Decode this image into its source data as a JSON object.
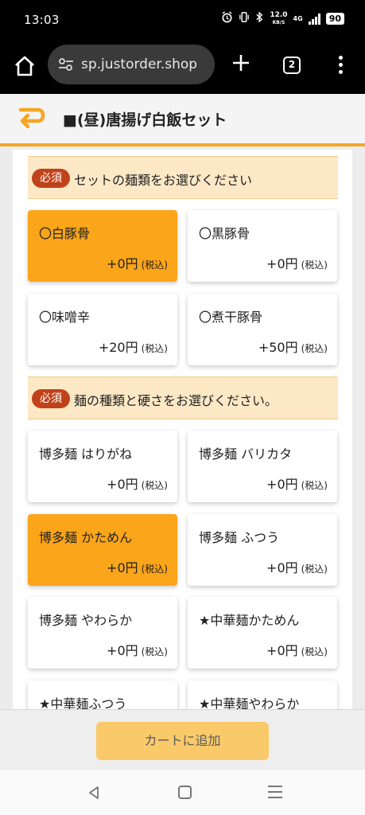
{
  "status_bar": {
    "time": "13:03",
    "speed_value": "12.0",
    "speed_unit": "KB/S",
    "network": "4G",
    "battery": "90",
    "icons": [
      "alarm-icon",
      "vibrate-icon",
      "bluetooth-icon",
      "signal-icon",
      "battery-icon"
    ]
  },
  "browser": {
    "url": "sp.justorder.shop",
    "tab_count": "2",
    "icons": [
      "home-icon",
      "site-settings-icon",
      "new-tab-icon",
      "tabs-icon",
      "menu-icon"
    ]
  },
  "page": {
    "title": "■(昼)唐揚げ白飯セット",
    "accent_color": "#f5a623",
    "selected_color": "#faa51a"
  },
  "sections": [
    {
      "badge": "必須",
      "text": "セットの麺類をお選びください",
      "options": [
        {
          "name": "〇白豚骨",
          "price": "+0円",
          "tax": "(税込)",
          "selected": true
        },
        {
          "name": "〇黒豚骨",
          "price": "+0円",
          "tax": "(税込)",
          "selected": false
        },
        {
          "name": "〇味噌辛",
          "price": "+20円",
          "tax": "(税込)",
          "selected": false
        },
        {
          "name": "〇煮干豚骨",
          "price": "+50円",
          "tax": "(税込)",
          "selected": false
        }
      ]
    },
    {
      "badge": "必須",
      "text": "麺の種類と硬さをお選びください。",
      "options": [
        {
          "name": "博多麺 はりがね",
          "price": "+0円",
          "tax": "(税込)",
          "selected": false
        },
        {
          "name": "博多麺 バリカタ",
          "price": "+0円",
          "tax": "(税込)",
          "selected": false
        },
        {
          "name": "博多麺 かためん",
          "price": "+0円",
          "tax": "(税込)",
          "selected": true
        },
        {
          "name": "博多麺 ふつう",
          "price": "+0円",
          "tax": "(税込)",
          "selected": false
        },
        {
          "name": "博多麺 やわらか",
          "price": "+0円",
          "tax": "(税込)",
          "selected": false
        },
        {
          "name": "★中華麺かためん",
          "price": "+0円",
          "tax": "(税込)",
          "selected": false
        },
        {
          "name": "★中華麺ふつう",
          "price": "",
          "tax": "",
          "selected": false
        },
        {
          "name": "★中華麺やわらか",
          "price": "",
          "tax": "",
          "selected": false
        }
      ]
    }
  ],
  "footer": {
    "cart_button": "カートに追加"
  }
}
